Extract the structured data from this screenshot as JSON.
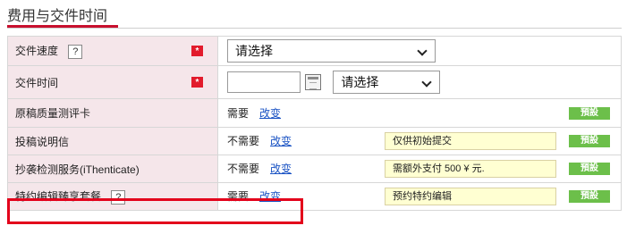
{
  "section": {
    "title": "费用与交件时间"
  },
  "rows": [
    {
      "label": "交件速度",
      "help": "?",
      "required_mark": "*",
      "select_value": "请选择"
    },
    {
      "label": "交件时间",
      "required_mark": "*",
      "select_value": "请选择",
      "date_value": ""
    },
    {
      "label": "原稿质量测评卡",
      "status": "需要",
      "change": "改变",
      "preset": "預設"
    },
    {
      "label": "投稿说明信",
      "status": "不需要",
      "change": "改变",
      "note": "仅供初始提交",
      "preset": "預設"
    },
    {
      "label": "抄袭检测服务(iThenticate)",
      "status": "不需要",
      "change": "改变",
      "note": "需额外支付 500 ¥ 元.",
      "preset": "預設"
    },
    {
      "label": "特约编辑臻享套餐",
      "help": "?",
      "status": "需要",
      "change": "改变",
      "note": "预约特约编辑",
      "preset": "預設"
    }
  ],
  "colors": {
    "accent": "#c8102e",
    "label_bg": "#f5e6ea",
    "preset_bg": "#6cbf4a",
    "note_bg": "#ffffd2",
    "highlight": "#e3001b"
  },
  "icons": {
    "calendar": "calendar-icon",
    "dropdown": "chevron-down-icon",
    "required": "required-asterisk-icon"
  }
}
